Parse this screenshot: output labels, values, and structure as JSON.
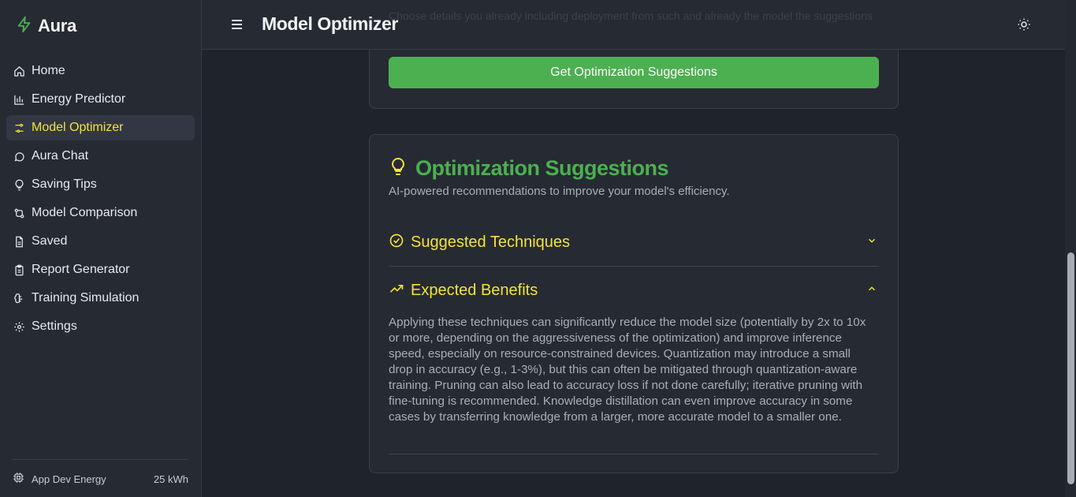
{
  "app": {
    "name": "Aura"
  },
  "header": {
    "title": "Model Optimizer",
    "ghost_text": "Choose details you already including deployment from such and already the model the suggestions"
  },
  "sidebar": {
    "items": [
      {
        "label": "Home",
        "icon": "home-icon",
        "active": false
      },
      {
        "label": "Energy Predictor",
        "icon": "bar-chart-icon",
        "active": false
      },
      {
        "label": "Model Optimizer",
        "icon": "sliders-icon",
        "active": true
      },
      {
        "label": "Aura Chat",
        "icon": "chat-bubble-icon",
        "active": false
      },
      {
        "label": "Saving Tips",
        "icon": "lightbulb-icon",
        "active": false
      },
      {
        "label": "Model Comparison",
        "icon": "compare-icon",
        "active": false
      },
      {
        "label": "Saved",
        "icon": "file-icon",
        "active": false
      },
      {
        "label": "Report Generator",
        "icon": "clipboard-icon",
        "active": false
      },
      {
        "label": "Training Simulation",
        "icon": "brain-icon",
        "active": false
      },
      {
        "label": "Settings",
        "icon": "gear-icon",
        "active": false
      }
    ],
    "footer": {
      "label": "App Dev Energy",
      "value": "25 kWh",
      "icon": "cpu-icon"
    }
  },
  "optimizer": {
    "button_label": "Get Optimization Suggestions"
  },
  "suggestions": {
    "title": "Optimization Suggestions",
    "subtitle": "AI-powered recommendations to improve your model's efficiency.",
    "sections": [
      {
        "title": "Suggested Techniques",
        "expanded": false,
        "icon": "check-circle-icon"
      },
      {
        "title": "Expected Benefits",
        "expanded": true,
        "icon": "trending-up-icon",
        "body": "Applying these techniques can significantly reduce the model size (potentially by 2x to 10x or more, depending on the aggressiveness of the optimization) and improve inference speed, especially on resource-constrained devices. Quantization may introduce a small drop in accuracy (e.g., 1-3%), but this can often be mitigated through quantization-aware training. Pruning can also lead to accuracy loss if not done carefully; iterative pruning with fine-tuning is recommended. Knowledge distillation can even improve accuracy in some cases by transferring knowledge from a larger, more accurate model to a smaller one."
      }
    ]
  },
  "colors": {
    "accent_green": "#4caf50",
    "accent_yellow": "#f3e23c",
    "background": "#1f232b",
    "panel": "#262a33"
  }
}
